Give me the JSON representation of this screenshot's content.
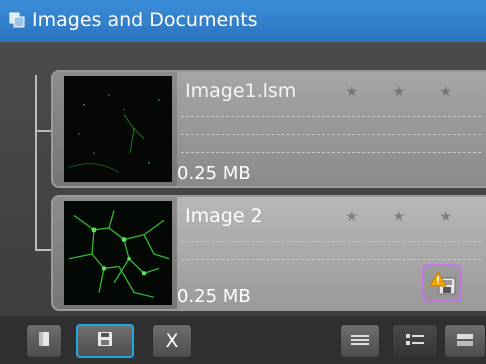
{
  "window": {
    "title": "Images and Documents",
    "title_icon": "images-documents-icon"
  },
  "items": [
    {
      "name": "Image1.lsm",
      "size": "0.25 MB",
      "rating_stars": "★ ★ ★",
      "thumbnail": "fluorescence-thumbnail-sparse"
    },
    {
      "name": "Image 2",
      "size": "0.25 MB",
      "rating_stars": "★ ★ ★",
      "thumbnail": "fluorescence-thumbnail-neurons",
      "warning_icon": "unsaved-warning-icon"
    }
  ],
  "toolbar": {
    "new_icon": "new-document-icon",
    "save_icon": "save-disk-icon",
    "close_label": "X",
    "list_view_icon": "list-view-icon",
    "detail_view_icon": "detail-view-icon",
    "gallery_view_icon": "gallery-view-icon"
  },
  "colors": {
    "title_bar": "#2f7fcc",
    "save_highlight": "#23a7e0",
    "warning_highlight": "#c476e8",
    "fluorescence": "#3fc23f"
  }
}
